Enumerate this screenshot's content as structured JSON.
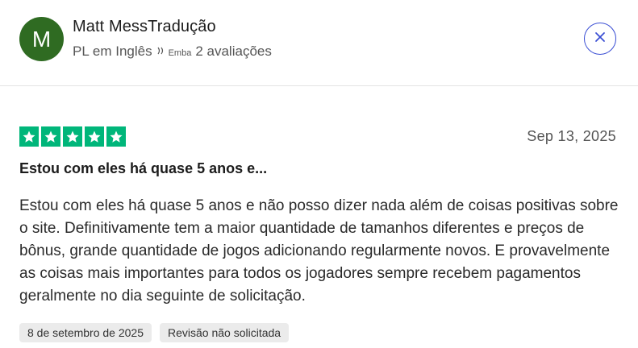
{
  "reviewer": {
    "avatar_initial": "M",
    "name": "Matt MessTradução",
    "country": "PL em Inglês",
    "translate_icon": "translate-icon",
    "translate_label": "Emba",
    "reviews_count": "2 avaliações"
  },
  "colors": {
    "avatar_bg": "#2f6b22",
    "star_green": "#00b67a",
    "close_blue": "#3b4fd4"
  },
  "review": {
    "rating": 5,
    "date": "Sep 13, 2025",
    "title": "Estou com eles há quase 5 anos e...",
    "body": "Estou com eles há quase 5 anos e não posso dizer nada além de coisas positivas sobre o site. Definitivamente tem a maior quantidade de tamanhos diferentes e preços de bônus, grande quantidade de jogos adicionando regularmente novos. E provavelmente as coisas mais importantes para todos os jogadores sempre recebem pagamentos geralmente no dia seguinte de solicitação.",
    "experience_date": "8 de setembro de 2025",
    "review_type": "Revisão não solicitada"
  },
  "close_icon": "close-icon"
}
